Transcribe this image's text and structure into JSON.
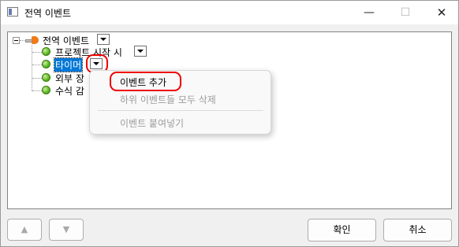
{
  "window": {
    "title": "전역 이벤트",
    "minimize_glyph": "—",
    "maximize_glyph": "☐",
    "close_glyph": "✕"
  },
  "tree": {
    "root": {
      "label": "전역 이벤트",
      "icon": "event-bulb-icon"
    },
    "items": [
      {
        "label": "프로젝트 시작 시",
        "icon": "green-dot-icon",
        "selected": false
      },
      {
        "label": "타이머",
        "icon": "green-dot-icon",
        "selected": true
      },
      {
        "label": "외부 장",
        "icon": "green-dot-icon",
        "selected": false
      },
      {
        "label": "수식 감",
        "icon": "green-dot-icon",
        "selected": false
      }
    ]
  },
  "context_menu": {
    "items": [
      {
        "label": "이벤트 추가",
        "enabled": true
      },
      {
        "label": "하위 이벤트들 모두 삭제",
        "enabled": false
      },
      {
        "label": "이벤트 붙여넣기",
        "enabled": false
      }
    ]
  },
  "buttons": {
    "up": "▲",
    "down": "▼",
    "ok": "확인",
    "cancel": "취소"
  },
  "colors": {
    "selection": "#0078d7",
    "highlight_ring": "#e00000",
    "status_dot": "#59b51f",
    "root_icon": "#ef7a1a"
  }
}
